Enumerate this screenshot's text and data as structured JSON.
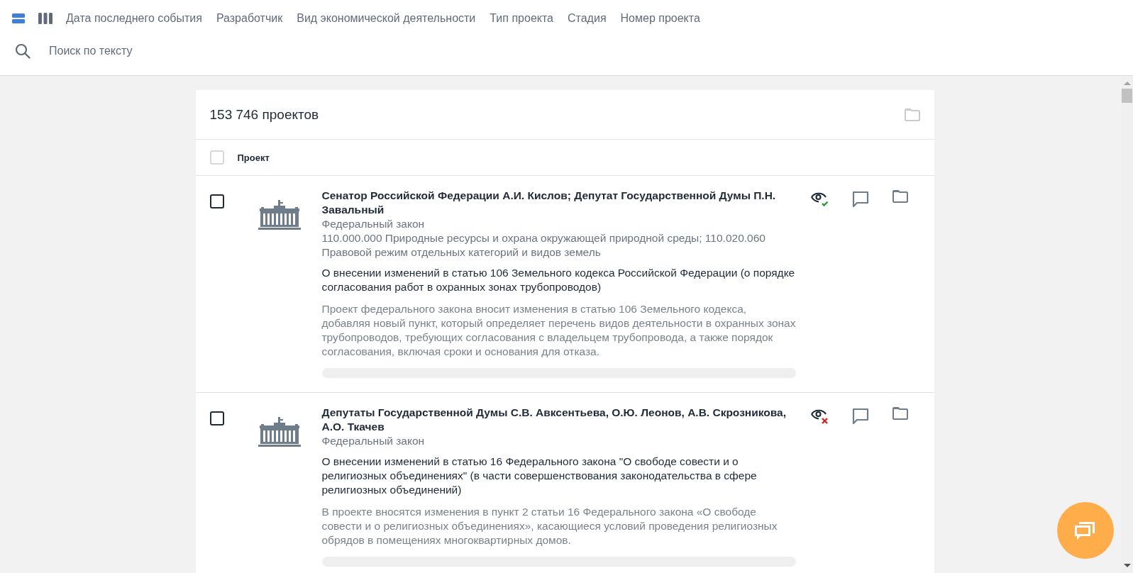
{
  "toolbar": {
    "view_modes": [
      {
        "kind": "list",
        "selected": true
      },
      {
        "kind": "columns",
        "selected": false
      }
    ],
    "filters": [
      "Дата последнего события",
      "Разработчик",
      "Вид экономической деятельности",
      "Тип проекта",
      "Стадия",
      "Номер проекта"
    ],
    "search": {
      "placeholder": "Поиск по тексту"
    }
  },
  "list": {
    "count": "153 746 проектов",
    "column_header": "Проект",
    "select_all_checked": false,
    "projects": [
      {
        "checked": false,
        "viewed": true,
        "developer": "Сенатор Российской Федерации А.И. Кислов; Депутат Государственной Думы П.Н. Завальный",
        "type": "Федеральный закон",
        "classifier": "110.000.000 Природные ресурсы и охрана окружающей природной среды; 110.020.060 Правовой режим отдельных категорий и видов земель",
        "title": "О внесении изменений в статью 106 Земельного кодекса Российской Федерации (о порядке согласования работ в охранных зонах трубопроводов)",
        "summary": "Проект федерального закона вносит изменения в статью 106 Земельного кодекса, добавляя новый пункт, который определяет перечень видов деятельности в охранных зонах трубопроводов, требующих согласования с владельцем трубопровода, а также порядок согласования, включая сроки и основания для отказа."
      },
      {
        "checked": false,
        "viewed": false,
        "developer": "Депутаты Государственной Думы С.В. Авксентьева, О.Ю. Леонов, А.В. Скрозникова, А.О. Ткачев",
        "type": "Федеральный закон",
        "title": "О внесении изменений в статью 16 Федерального закона \"О свободе совести и о религиозных объединениях\" (в части совершенствования законодательства в сфере религиозных объединений)",
        "summary": "В проекте вносятся изменения в пункт 2 статьи 16 Федерального закона «О свободе совести и о религиозных объединениях», касающиеся условий проведения религиозных обрядов в помещениях многоквартирных домов."
      }
    ]
  }
}
